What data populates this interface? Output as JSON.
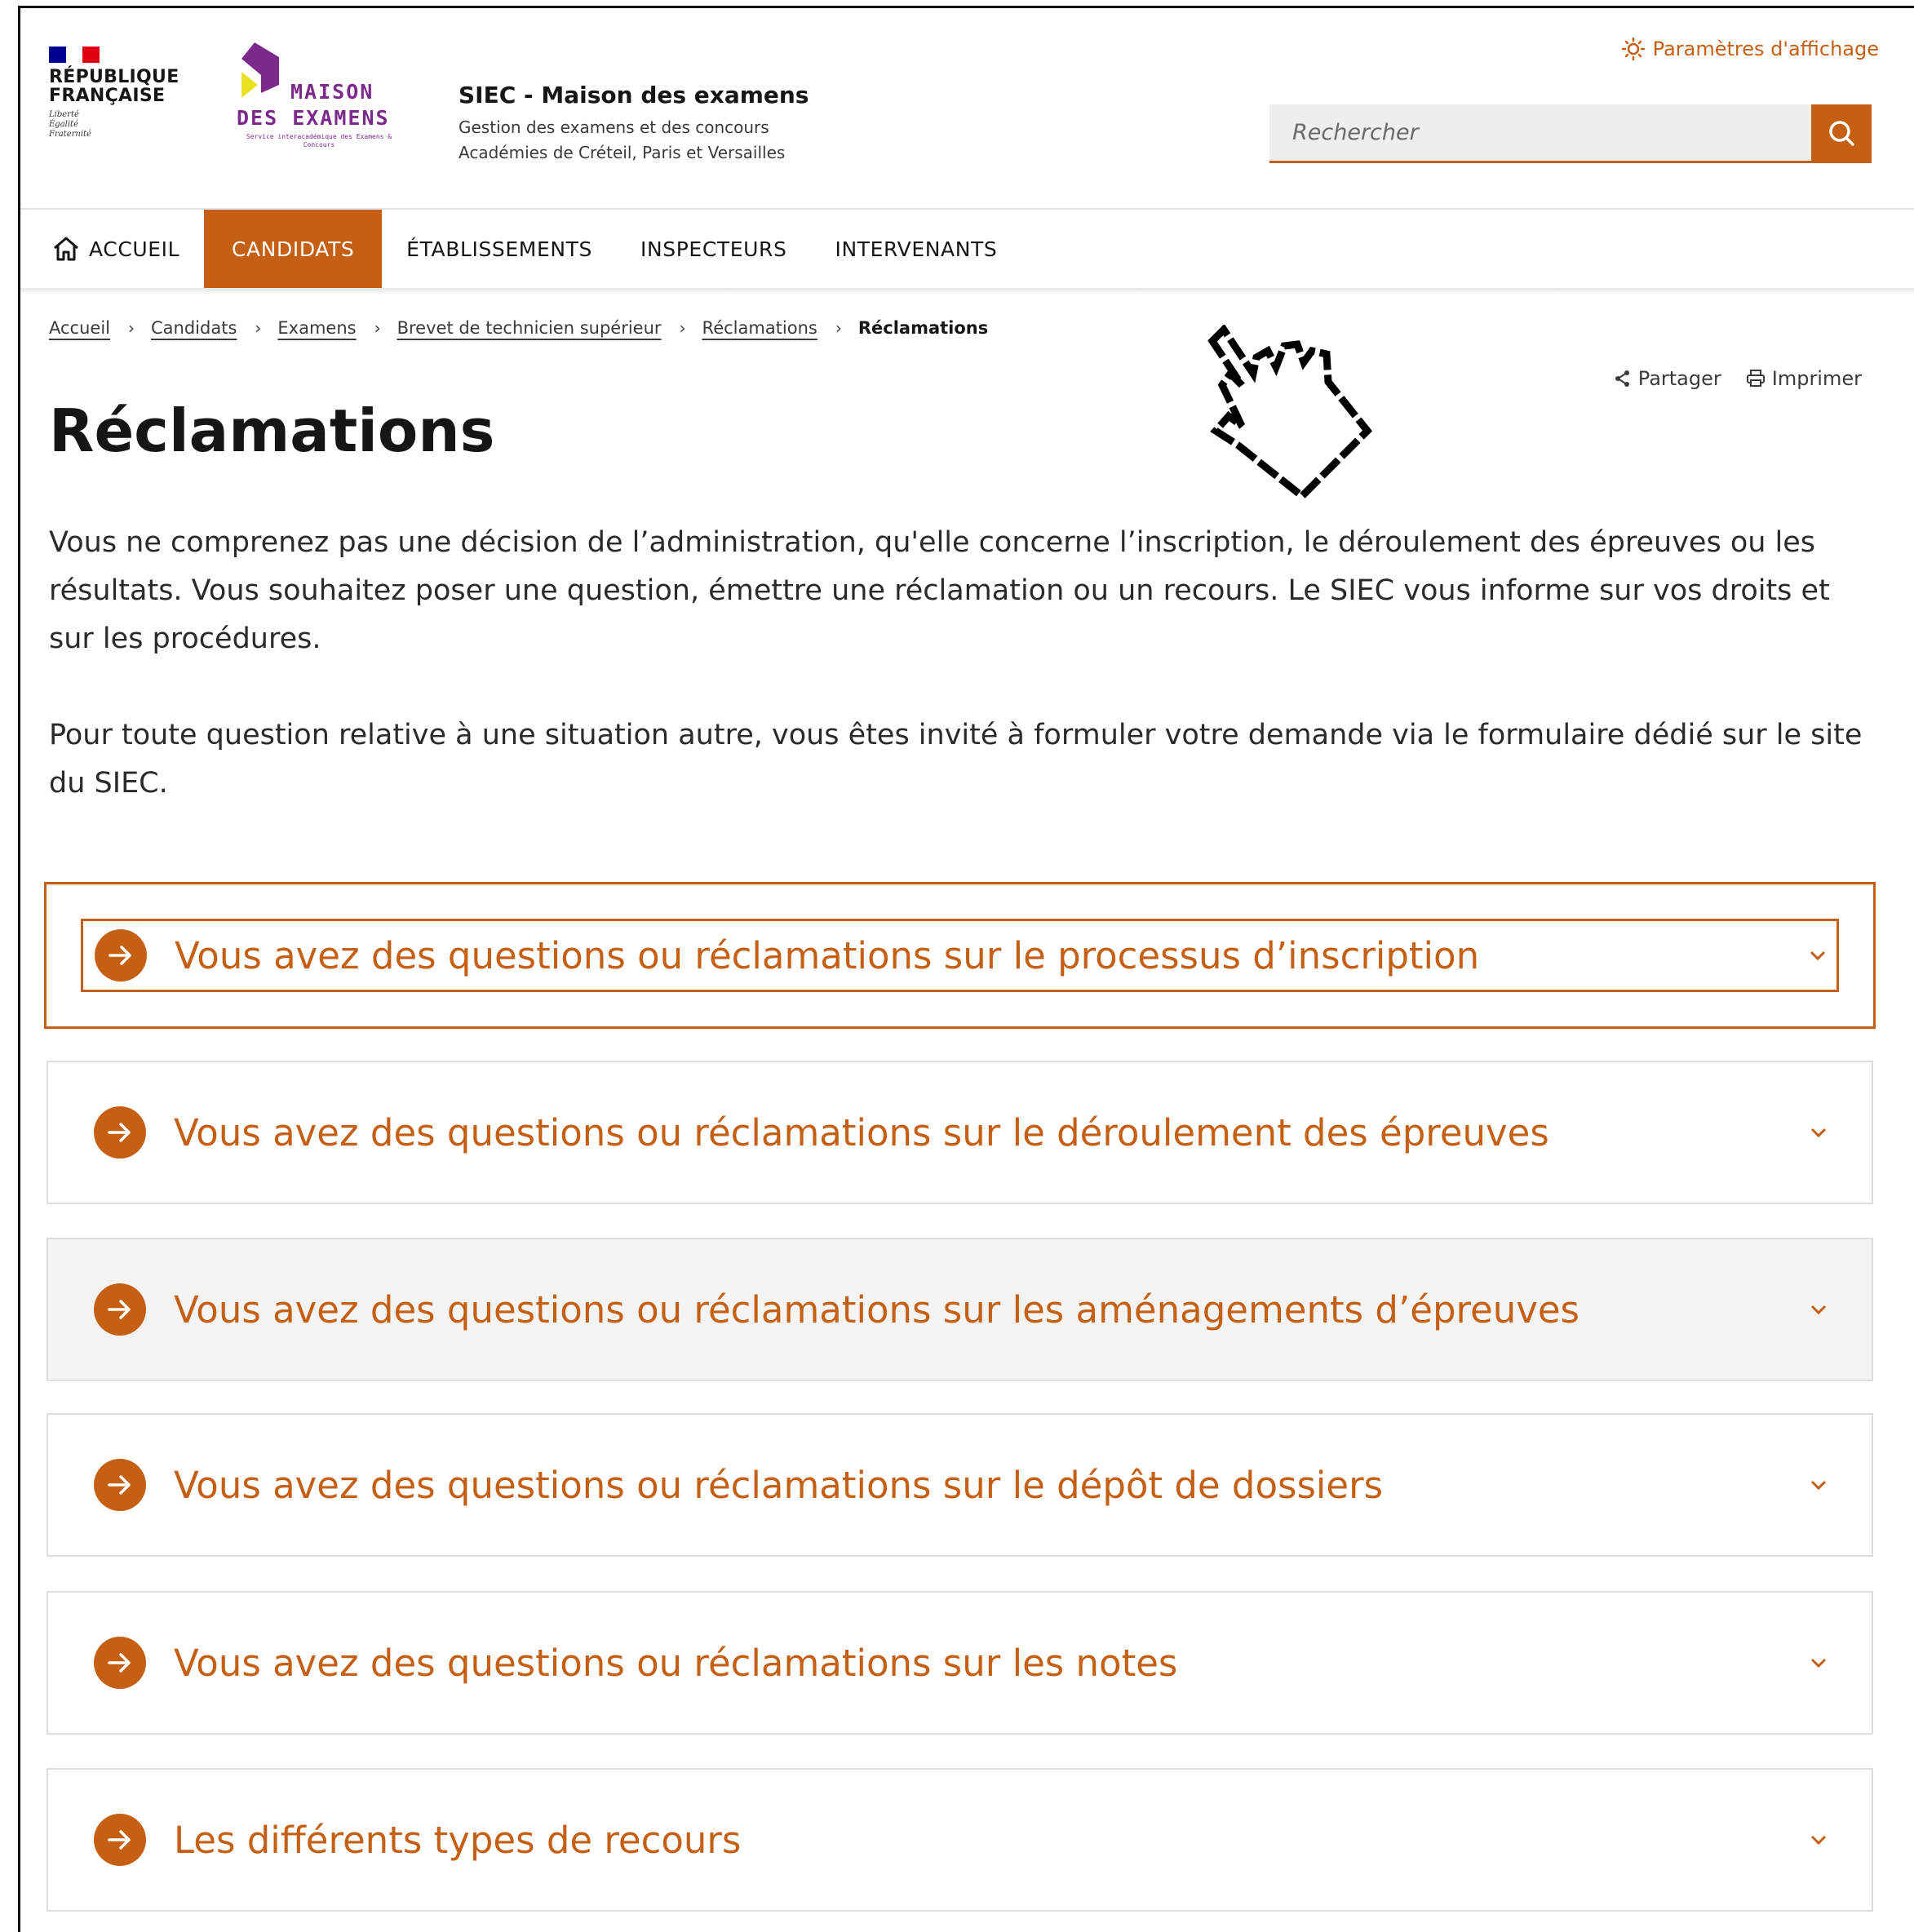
{
  "header": {
    "republique_line1": "RÉPUBLIQUE",
    "republique_line2": "FRANÇAISE",
    "devise": [
      "Liberté",
      "Égalité",
      "Fraternité"
    ],
    "logo_line1": "MAISON",
    "logo_line2": "DES EXAMENS",
    "logo_tagline": "Service interacadémique des Examens & Concours",
    "site_title": "SIEC - Maison des examens",
    "site_subtitle_1": "Gestion des examens et des concours",
    "site_subtitle_2": "Académies de Créteil, Paris et Versailles",
    "display_settings": "Paramètres d'affichage",
    "search_placeholder": "Rechercher"
  },
  "nav": {
    "home": "ACCUEIL",
    "items": [
      "CANDIDATS",
      "ÉTABLISSEMENTS",
      "INSPECTEURS",
      "INTERVENANTS"
    ],
    "active": "CANDIDATS"
  },
  "breadcrumb": [
    "Accueil",
    "Candidats",
    "Examens",
    "Brevet de technicien supérieur",
    "Réclamations",
    "Réclamations"
  ],
  "tools": {
    "share": "Partager",
    "print": "Imprimer"
  },
  "page": {
    "title": "Réclamations",
    "intro_1": "Vous ne comprenez pas une décision de l’administration, qu'elle concerne l’inscription, le déroulement des épreuves ou les résultats. Vous souhaitez poser une question, émettre une réclamation ou un recours. Le SIEC vous informe sur vos droits et sur les procédures.",
    "intro_2": "Pour toute question relative à une situation autre, vous êtes invité à formuler votre demande via le formulaire dédié sur le site du SIEC."
  },
  "accordion": [
    "Vous avez des questions ou réclamations sur le processus d’inscription",
    "Vous avez des questions ou réclamations sur le déroulement des épreuves",
    "Vous avez des questions ou réclamations sur les aménagements d’épreuves",
    "Vous avez des questions ou réclamations sur le dépôt de dossiers",
    "Vous avez des questions ou réclamations sur les notes",
    "Les différents types de recours"
  ],
  "colors": {
    "accent": "#c45f14",
    "flag_blue": "#000091",
    "flag_red": "#e1000f",
    "logo_purple": "#7b2a8c",
    "logo_yellow": "#e8e221"
  },
  "icons": [
    "home-icon",
    "search-icon",
    "sun-icon",
    "share-icon",
    "print-icon",
    "arrow-right-icon",
    "chevron-down-icon",
    "hand-cursor-icon"
  ]
}
